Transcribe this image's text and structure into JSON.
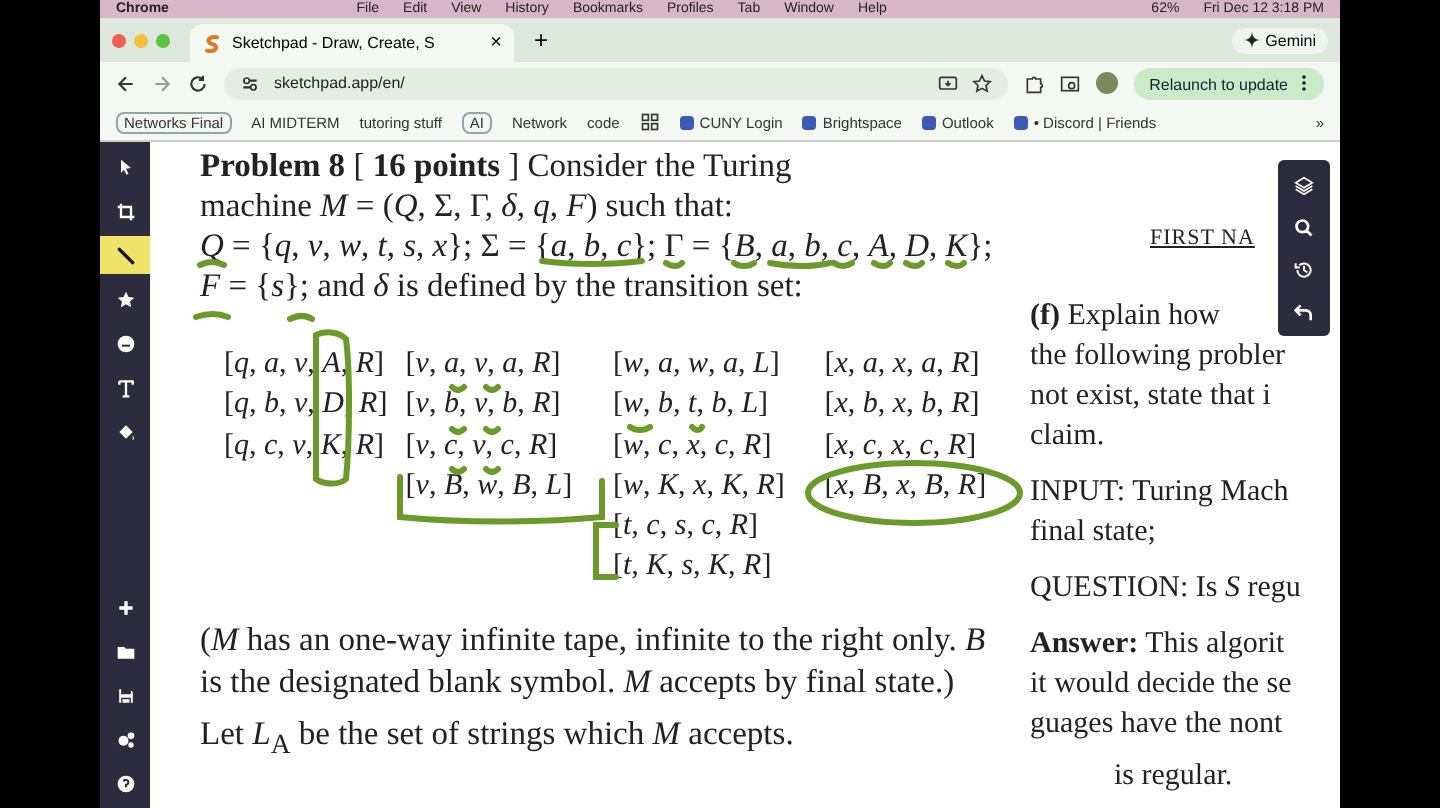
{
  "menu_bar": {
    "items": [
      "Chrome",
      "File",
      "Edit",
      "View",
      "History",
      "Bookmarks",
      "Profiles",
      "Tab",
      "Window",
      "Help"
    ],
    "battery": "62%",
    "clock": "Fri Dec 12  3:18 PM"
  },
  "tab": {
    "title": "Sketchpad - Draw, Create, S",
    "close": "×",
    "new_tab": "+"
  },
  "gemini": "Gemini",
  "address": {
    "url": "sketchpad.app/en/"
  },
  "relaunch": "Relaunch to update",
  "bookmarks": [
    {
      "label": "Networks Final",
      "kind": "chip"
    },
    {
      "label": "AI MIDTERM",
      "kind": "plain"
    },
    {
      "label": "tutoring stuff",
      "kind": "plain"
    },
    {
      "label": "AI",
      "kind": "chip"
    },
    {
      "label": "Network",
      "kind": "plain"
    },
    {
      "label": "code",
      "kind": "plain"
    },
    {
      "kind": "apps"
    },
    {
      "label": "CUNY Login",
      "kind": "site"
    },
    {
      "label": "Brightspace",
      "kind": "site"
    },
    {
      "label": "Outlook",
      "kind": "site"
    },
    {
      "label": "• Discord | Friends",
      "kind": "site"
    }
  ],
  "bookmarks_more": "»",
  "tools_top": [
    {
      "selected": false
    },
    {
      "selected": false
    },
    {
      "selected": true
    },
    {
      "selected": false
    },
    {
      "selected": false
    },
    {
      "selected": false
    },
    {
      "selected": false
    }
  ],
  "tools_bottom": [
    {
      "selected": false
    },
    {
      "selected": false
    },
    {
      "selected": false
    },
    {
      "selected": false
    },
    {
      "selected": false
    }
  ],
  "problem": {
    "lines": [
      "**Problem 8**   [ **16 points** ]  Consider the Turing",
      "machine *M* = (*Q*, Σ, Γ, *δ*, *q*, *F*) such that:",
      "*Q* = {*q*, *v*, *w*, *t*, *s*, *x*}; Σ = {*a*, *b*, *c*}; Γ = {*B*, *a*, *b*, *c*, *A*, *D*, *K*};",
      "*F* = {*s*}; and *δ* is defined by the transition set:"
    ],
    "transition_columns": [
      [
        "[*q*, *a*, *v*, *A*, *R*]",
        "[*q*, *b*, *v*, *D*, *R*]",
        "[*q*, *c*, *v*, *K*, *R*]"
      ],
      [
        "[*v*, *a*, *v*, *a*, *R*]",
        "[*v*, *b*, *v*, *b*, *R*]",
        "[*v*, *c*, *v*, *c*, *R*]",
        "[*v*, *B*, *w*, *B*, *L*]"
      ],
      [
        "[*w*, *a*, *w*, *a*, *L*]",
        "[*w*, *b*, *t*, *b*, *L*]",
        "[*w*, *c*, *x*, *c*, *R*]",
        "[*w*, *K*, *x*, *K*, *R*]",
        "[*t*, *c*, *s*, *c*, *R*]",
        "[*t*, *K*, *s*, *K*, *R*]"
      ],
      [
        "[*x*, *a*, *x*, *a*, *R*]",
        "[*x*, *b*, *x*, *b*, *R*]",
        "[*x*, *c*, *x*, *c*, *R*]",
        "[*x*, *B*, *x*, *B*, *R*]"
      ]
    ],
    "note": "(*M* has an one-way infinite tape, infinite to the right only.  *B* is the designated blank symbol.  *M* accepts by final state.)",
    "let_line": "Let *L*$_{A}$ be the set of strings which *M* accepts."
  },
  "right_column": {
    "header": "FIRST NA",
    "lines": [
      "**(f)** Explain how",
      "the following probler",
      "not exist, state that i",
      "claim."
    ],
    "input": [
      "INPUT:  Turing Mach",
      "final state;"
    ],
    "question": "QUESTION:  Is *S* regu",
    "answer": [
      "**Answer:** This algorit",
      "it would decide the se",
      "guages have the nont"
    ],
    "footer": "is regular."
  },
  "float_tools": [
    {
      "selected": false
    },
    {
      "selected": false
    },
    {
      "selected": false
    },
    {
      "selected": false
    }
  ]
}
